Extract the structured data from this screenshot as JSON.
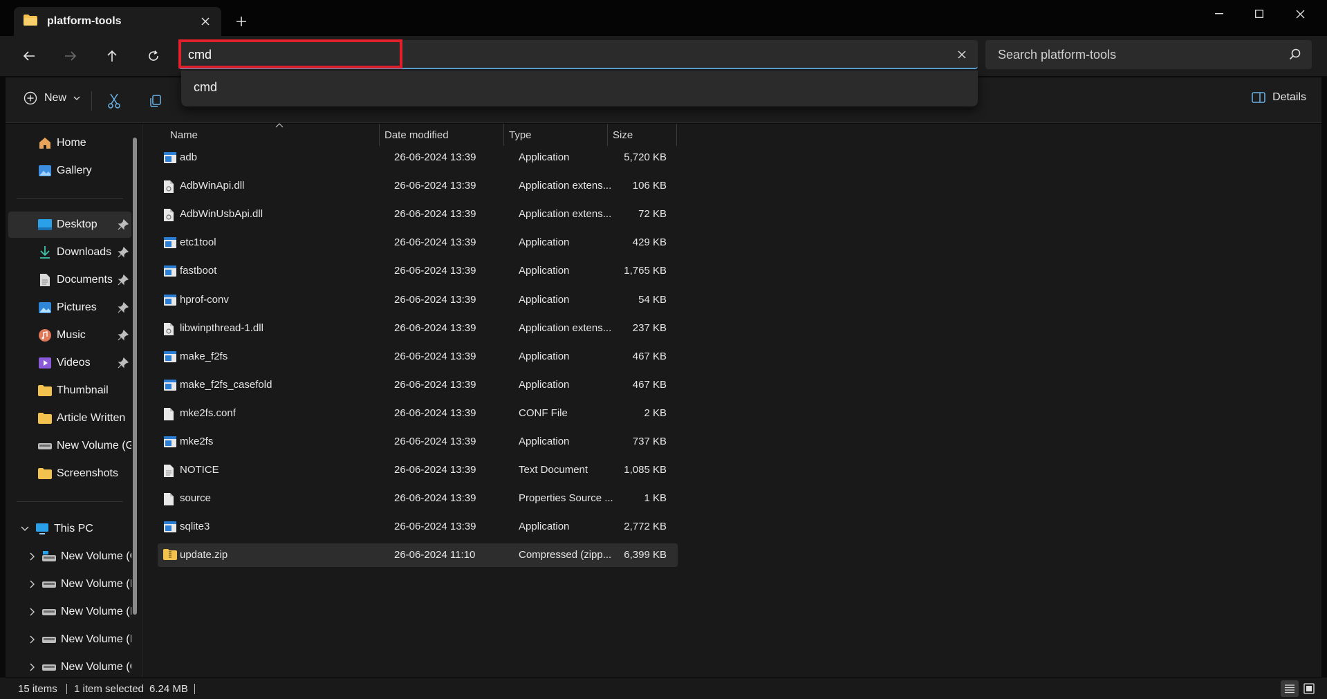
{
  "window": {
    "tab_title": "platform-tools",
    "colors": {
      "accent": "#5ea5d8",
      "highlight": "#e0202b",
      "folder": "#f2c14e",
      "background": "#191919"
    }
  },
  "navigation": {
    "back_icon": "arrow-left-icon",
    "forward_icon": "arrow-right-icon",
    "up_icon": "arrow-up-icon",
    "refresh_icon": "refresh-icon"
  },
  "address": {
    "value": "cmd",
    "suggestion": "cmd"
  },
  "search": {
    "placeholder": "Search platform-tools"
  },
  "toolbar": {
    "new_label": "New",
    "details_label": "Details"
  },
  "sidebar": {
    "quick": [
      {
        "label": "Home",
        "icon": "home-icon"
      },
      {
        "label": "Gallery",
        "icon": "gallery-icon"
      }
    ],
    "pinned": [
      {
        "label": "Desktop",
        "icon": "desktop-icon",
        "pinned": true,
        "selected": true
      },
      {
        "label": "Downloads",
        "icon": "download-icon",
        "pinned": true
      },
      {
        "label": "Documents",
        "icon": "document-icon",
        "pinned": true
      },
      {
        "label": "Pictures",
        "icon": "pictures-icon",
        "pinned": true
      },
      {
        "label": "Music",
        "icon": "music-icon",
        "pinned": true
      },
      {
        "label": "Videos",
        "icon": "videos-icon",
        "pinned": true
      },
      {
        "label": "Thumbnail",
        "icon": "folder-icon"
      },
      {
        "label": "Article Written",
        "icon": "folder-icon"
      },
      {
        "label": "New Volume (G:",
        "icon": "drive-icon"
      },
      {
        "label": "Screenshots",
        "icon": "folder-icon"
      }
    ],
    "this_pc": {
      "label": "This PC",
      "drives": [
        {
          "label": "New Volume (C"
        },
        {
          "label": "New Volume (I"
        },
        {
          "label": "New Volume (I"
        },
        {
          "label": "New Volume (I"
        },
        {
          "label": "New Volume (C"
        }
      ]
    }
  },
  "columns": {
    "name": "Name",
    "date": "Date modified",
    "type": "Type",
    "size": "Size"
  },
  "files": [
    {
      "name": "adb",
      "date": "26-06-2024 13:39",
      "type": "Application",
      "size": "5,720 KB",
      "icon": "application-icon"
    },
    {
      "name": "AdbWinApi.dll",
      "date": "26-06-2024 13:39",
      "type": "Application extens...",
      "size": "106 KB",
      "icon": "dll-file-icon"
    },
    {
      "name": "AdbWinUsbApi.dll",
      "date": "26-06-2024 13:39",
      "type": "Application extens...",
      "size": "72 KB",
      "icon": "dll-file-icon"
    },
    {
      "name": "etc1tool",
      "date": "26-06-2024 13:39",
      "type": "Application",
      "size": "429 KB",
      "icon": "application-icon"
    },
    {
      "name": "fastboot",
      "date": "26-06-2024 13:39",
      "type": "Application",
      "size": "1,765 KB",
      "icon": "application-icon"
    },
    {
      "name": "hprof-conv",
      "date": "26-06-2024 13:39",
      "type": "Application",
      "size": "54 KB",
      "icon": "application-icon"
    },
    {
      "name": "libwinpthread-1.dll",
      "date": "26-06-2024 13:39",
      "type": "Application extens...",
      "size": "237 KB",
      "icon": "dll-file-icon"
    },
    {
      "name": "make_f2fs",
      "date": "26-06-2024 13:39",
      "type": "Application",
      "size": "467 KB",
      "icon": "application-icon"
    },
    {
      "name": "make_f2fs_casefold",
      "date": "26-06-2024 13:39",
      "type": "Application",
      "size": "467 KB",
      "icon": "application-icon"
    },
    {
      "name": "mke2fs.conf",
      "date": "26-06-2024 13:39",
      "type": "CONF File",
      "size": "2 KB",
      "icon": "file-icon"
    },
    {
      "name": "mke2fs",
      "date": "26-06-2024 13:39",
      "type": "Application",
      "size": "737 KB",
      "icon": "application-icon"
    },
    {
      "name": "NOTICE",
      "date": "26-06-2024 13:39",
      "type": "Text Document",
      "size": "1,085 KB",
      "icon": "text-file-icon"
    },
    {
      "name": "source",
      "date": "26-06-2024 13:39",
      "type": "Properties Source ...",
      "size": "1 KB",
      "icon": "file-icon"
    },
    {
      "name": "sqlite3",
      "date": "26-06-2024 13:39",
      "type": "Application",
      "size": "2,772 KB",
      "icon": "application-icon"
    },
    {
      "name": "update.zip",
      "date": "26-06-2024 11:10",
      "type": "Compressed (zipp...",
      "size": "6,399 KB",
      "icon": "zip-folder-icon",
      "selected": true
    }
  ],
  "status": {
    "item_count": "15 items",
    "selection": "1 item selected",
    "selection_size": "6.24 MB"
  }
}
